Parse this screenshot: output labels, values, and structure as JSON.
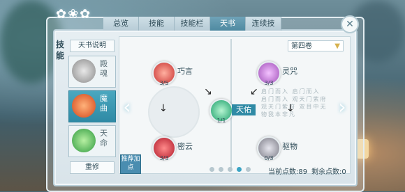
{
  "tabs": [
    "总览",
    "技能",
    "技能栏",
    "天书",
    "连续技"
  ],
  "active_tab": 3,
  "sidebar_label": "技能",
  "intro_button": "天书说明",
  "side_items": [
    {
      "label": "殿魂",
      "selected": false,
      "color": "#9a9a9a"
    },
    {
      "label": "魔曲",
      "selected": true,
      "color": "#e06a25"
    },
    {
      "label": "天命",
      "selected": false,
      "color": "#3fa84c"
    }
  ],
  "practice_button": "重修",
  "recommend_button": "推荐加点",
  "volume_select": "第四卷",
  "nodes": {
    "qiaoyan": {
      "name": "巧言",
      "count": "3/5",
      "color": "#c83030"
    },
    "miyun": {
      "name": "密云",
      "count": "3/3",
      "color": "#b01a2a"
    },
    "tianyou": {
      "name": "天佑",
      "count": "1/1",
      "color": "#1a9f6a"
    },
    "lingzhou": {
      "name": "灵咒",
      "count": "3/3",
      "color": "#a04fb8"
    },
    "quwu": {
      "name": "驱物",
      "count": "0/3",
      "color": "#7a7a84"
    }
  },
  "pagination": {
    "total": 5,
    "active": 3
  },
  "current_points_label": "当前点数:89",
  "remaining_points_label": "剩余点数:0",
  "colors": {
    "accent": "#2f8aa5",
    "tab_active": "#4f8aa1"
  }
}
